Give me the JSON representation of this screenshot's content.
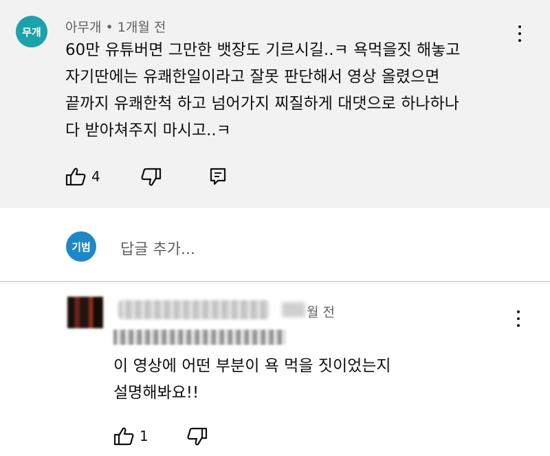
{
  "comment": {
    "avatar_text": "무개",
    "avatar_color": "#1aa3a8",
    "author": "아무개",
    "separator": "•",
    "time": "1개월 전",
    "text": "60만 유튜버면 그만한 뱃장도 기르시길..ㅋ 욕먹을짓 해놓고\n자기딴에는 유쾌한일이라고 잘못 판단해서 영상 올렸으면\n끝까지 유쾌한척 하고 넘어가지 찌질하게 대댓으로 하나하나\n다 받아쳐주지 마시고..ㅋ",
    "like_count": "4",
    "icons": [
      "thumbs-up-icon",
      "thumbs-down-icon",
      "reply-icon",
      "more-vert-icon"
    ]
  },
  "reply_box": {
    "avatar_text": "기범",
    "avatar_color": "#1e88c7",
    "placeholder": "답글 추가..."
  },
  "reply": {
    "time_suffix": "월 전",
    "text": "이 영상에 어떤 부분이 욕 먹을 짓이었는지\n설명해봐요!!",
    "like_count": "1",
    "icons": [
      "thumbs-up-icon",
      "thumbs-down-icon",
      "more-vert-icon"
    ]
  }
}
